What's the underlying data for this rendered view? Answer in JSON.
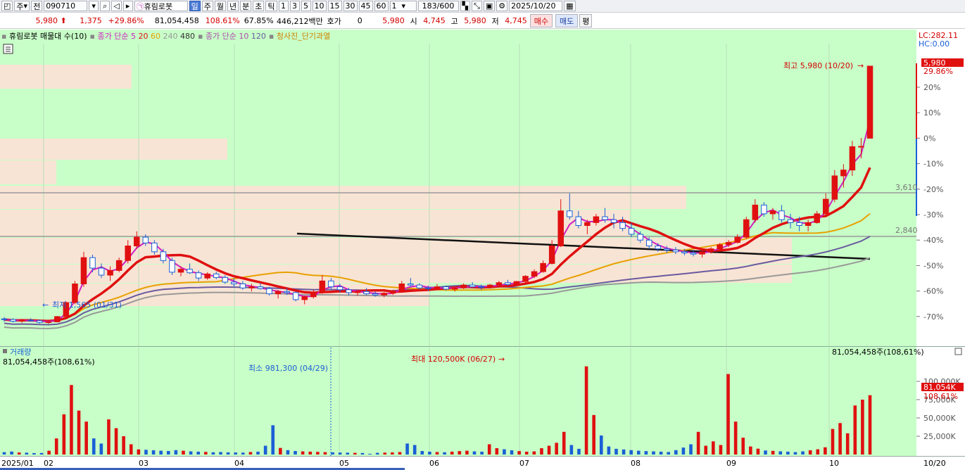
{
  "toolbar": {
    "market": "주",
    "market2": "전",
    "code": "090710",
    "stock_name": "휴림로봇",
    "periods": [
      "일",
      "주",
      "월",
      "년",
      "분",
      "초",
      "틱"
    ],
    "minutes": [
      "1",
      "3",
      "5",
      "10",
      "15",
      "30",
      "45",
      "60"
    ],
    "unit": "1",
    "count": "183/600",
    "date": "2025/10/20"
  },
  "quote": {
    "price": "5,980",
    "change": "1,375",
    "change_pct": "+29.86%",
    "volume": "81,054,458",
    "volume_ratio": "108.61%",
    "turnover": "67.85%",
    "amount": "446,212백만",
    "hoga_label": "호가",
    "hoga_value": "0",
    "hoga_price": "5,980",
    "open_label": "시",
    "open": "4,745",
    "high_label": "고",
    "high": "5,980",
    "low_label": "저",
    "low": "4,745",
    "buy": "매수",
    "sell": "매도",
    "avg": "평"
  },
  "legend": {
    "item1": "휴림로봇 매물대 수(10)",
    "item2": "종가 단순 5",
    "item2_20": "20",
    "item2_60": "60",
    "item2_240": "240",
    "item2_480": "480",
    "item3": "종가 단순 10",
    "item3_120": "120",
    "item4": "청사진_단기과열"
  },
  "price_panel": {
    "lc": "LC:282.11",
    "hc": "HC:0.00",
    "max_label": "최고 5,980 (10/20)",
    "min_label": "최저 1,565 (01/31)",
    "current_tag": "5,980",
    "current_pct": "29.86%",
    "line1_label": "3,610",
    "line2_label": "2,840",
    "y_ticks": [
      "20%",
      "10%",
      "0%",
      "-10%",
      "-20%",
      "-30%",
      "-40%",
      "-50%",
      "-60%",
      "-70%"
    ]
  },
  "volume_panel": {
    "title": "거래량",
    "left_value": "81,054,458주(108,61%)",
    "right_value": "81,054,458주(108,61%)",
    "max_label": "최대 120,500K (06/27)",
    "min_label": "최소 981,300 (04/29)",
    "current_tag": "81,054K",
    "current_pct": "108.61%",
    "y_ticks": [
      "100,000K",
      "75,000K",
      "50,000K",
      "25,000K"
    ]
  },
  "x_axis": [
    "2025/01",
    "02",
    "03",
    "04",
    "05",
    "06",
    "07",
    "08",
    "09",
    "10",
    "10/20"
  ],
  "colors": {
    "up": "#e01010",
    "down": "#1b5fd6",
    "ma5": "#d020c0",
    "ma20": "#e01010",
    "ma60": "#e8a000",
    "ma120": "#6a5aa0",
    "ma240": "#999999",
    "panel_bg": "#c8ffc8",
    "volume_profile": "#f8e4d4"
  },
  "chart_data": {
    "type": "candlestick",
    "ylim": [
      1400,
      6100
    ],
    "candles": [
      [
        1650,
        1680,
        1600,
        1640
      ],
      [
        1640,
        1660,
        1590,
        1610
      ],
      [
        1610,
        1650,
        1580,
        1630
      ],
      [
        1630,
        1660,
        1600,
        1620
      ],
      [
        1620,
        1640,
        1570,
        1590
      ],
      [
        1590,
        1620,
        1565,
        1600
      ],
      [
        1600,
        1700,
        1590,
        1690
      ],
      [
        1690,
        1950,
        1680,
        1930
      ],
      [
        1930,
        2300,
        1900,
        2250
      ],
      [
        2250,
        2800,
        2200,
        2700
      ],
      [
        2700,
        2750,
        2450,
        2520
      ],
      [
        2520,
        2600,
        2350,
        2400
      ],
      [
        2400,
        2550,
        2300,
        2480
      ],
      [
        2480,
        2700,
        2450,
        2650
      ],
      [
        2650,
        3000,
        2600,
        2900
      ],
      [
        2900,
        3150,
        2850,
        3050
      ],
      [
        3050,
        3100,
        2900,
        2950
      ],
      [
        2950,
        3000,
        2750,
        2800
      ],
      [
        2800,
        2850,
        2600,
        2650
      ],
      [
        2650,
        2700,
        2400,
        2450
      ],
      [
        2450,
        2550,
        2380,
        2500
      ],
      [
        2500,
        2600,
        2420,
        2440
      ],
      [
        2440,
        2480,
        2300,
        2350
      ],
      [
        2350,
        2450,
        2320,
        2420
      ],
      [
        2420,
        2460,
        2330,
        2360
      ],
      [
        2360,
        2400,
        2250,
        2280
      ],
      [
        2280,
        2350,
        2200,
        2250
      ],
      [
        2250,
        2300,
        2150,
        2180
      ],
      [
        2180,
        2250,
        2120,
        2200
      ],
      [
        2200,
        2260,
        2150,
        2170
      ],
      [
        2170,
        2200,
        2050,
        2080
      ],
      [
        2080,
        2150,
        2000,
        2120
      ],
      [
        2120,
        2180,
        2060,
        2100
      ],
      [
        2100,
        2120,
        1950,
        1980
      ],
      [
        1980,
        2050,
        1900,
        2030
      ],
      [
        2030,
        2150,
        2000,
        2100
      ],
      [
        2100,
        2400,
        2080,
        2300
      ],
      [
        2300,
        2350,
        2150,
        2200
      ],
      [
        2200,
        2250,
        2100,
        2150
      ],
      [
        2150,
        2180,
        2050,
        2100
      ],
      [
        2100,
        2150,
        2050,
        2120
      ],
      [
        2120,
        2180,
        2060,
        2080
      ],
      [
        2080,
        2120,
        2030,
        2060
      ],
      [
        2060,
        2110,
        2020,
        2090
      ],
      [
        2090,
        2150,
        2060,
        2120
      ],
      [
        2120,
        2300,
        2100,
        2250
      ],
      [
        2250,
        2350,
        2200,
        2230
      ],
      [
        2230,
        2260,
        2150,
        2180
      ],
      [
        2180,
        2220,
        2130,
        2170
      ],
      [
        2170,
        2250,
        2150,
        2200
      ],
      [
        2200,
        2220,
        2140,
        2160
      ],
      [
        2160,
        2200,
        2120,
        2180
      ],
      [
        2180,
        2260,
        2160,
        2230
      ],
      [
        2230,
        2280,
        2180,
        2200
      ],
      [
        2200,
        2240,
        2150,
        2190
      ],
      [
        2190,
        2250,
        2170,
        2230
      ],
      [
        2230,
        2300,
        2200,
        2270
      ],
      [
        2270,
        2320,
        2220,
        2240
      ],
      [
        2240,
        2300,
        2220,
        2290
      ],
      [
        2290,
        2400,
        2270,
        2380
      ],
      [
        2380,
        2500,
        2350,
        2460
      ],
      [
        2460,
        2650,
        2440,
        2600
      ],
      [
        2600,
        3000,
        2580,
        2900
      ],
      [
        2900,
        3700,
        2880,
        3500
      ],
      [
        3500,
        3800,
        3350,
        3400
      ],
      [
        3400,
        3500,
        3200,
        3250
      ],
      [
        3250,
        3350,
        3100,
        3300
      ],
      [
        3300,
        3450,
        3250,
        3400
      ],
      [
        3400,
        3550,
        3300,
        3350
      ],
      [
        3350,
        3450,
        3200,
        3300
      ],
      [
        3300,
        3400,
        3150,
        3200
      ],
      [
        3200,
        3300,
        3050,
        3100
      ],
      [
        3100,
        3150,
        2950,
        3000
      ],
      [
        3000,
        3050,
        2850,
        2900
      ],
      [
        2900,
        2950,
        2800,
        2850
      ],
      [
        2850,
        2900,
        2780,
        2830
      ],
      [
        2830,
        2880,
        2760,
        2800
      ],
      [
        2800,
        2850,
        2740,
        2780
      ],
      [
        2780,
        2830,
        2720,
        2760
      ],
      [
        2760,
        2820,
        2700,
        2800
      ],
      [
        2800,
        2880,
        2770,
        2850
      ],
      [
        2850,
        2950,
        2820,
        2920
      ],
      [
        2920,
        3000,
        2880,
        2960
      ],
      [
        2960,
        3100,
        2940,
        3050
      ],
      [
        3050,
        3400,
        3020,
        3350
      ],
      [
        3350,
        3700,
        3300,
        3600
      ],
      [
        3600,
        3650,
        3400,
        3450
      ],
      [
        3450,
        3550,
        3350,
        3500
      ],
      [
        3500,
        3600,
        3300,
        3350
      ],
      [
        3350,
        3450,
        3200,
        3300
      ],
      [
        3300,
        3400,
        3150,
        3250
      ],
      [
        3250,
        3350,
        3150,
        3300
      ],
      [
        3300,
        3500,
        3280,
        3450
      ],
      [
        3450,
        3800,
        3400,
        3700
      ],
      [
        3700,
        4200,
        3650,
        4100
      ],
      [
        4100,
        4300,
        3900,
        4200
      ],
      [
        4200,
        4700,
        4100,
        4600
      ],
      [
        4600,
        4750,
        4400,
        4605
      ],
      [
        4745,
        5980,
        4745,
        5980
      ]
    ],
    "volume_k": [
      3200,
      4100,
      2800,
      2500,
      1900,
      2100,
      5200,
      22000,
      55000,
      95000,
      60000,
      45000,
      22000,
      15000,
      48000,
      36000,
      25000,
      14000,
      7000,
      6500,
      5800,
      5200,
      4800,
      6000,
      5200,
      4300,
      3900,
      3600,
      3100,
      3400,
      3000,
      2800,
      2600,
      3400,
      3900,
      12000,
      40000,
      9000,
      6000,
      4800,
      4300,
      3900,
      3600,
      3300,
      3000,
      2700,
      2500,
      2300,
      2100,
      981,
      2300,
      2600,
      2900,
      3400,
      15000,
      13000,
      4800,
      3900,
      3400,
      3100,
      3900,
      4700,
      5200,
      4300,
      3900,
      14000,
      8700,
      7200,
      5800,
      4700,
      3900,
      4300,
      8600,
      12000,
      16000,
      31000,
      13000,
      7800,
      120500,
      54000,
      26000,
      11000,
      7800,
      6900,
      6000,
      5200,
      4700,
      4300,
      3900,
      3400,
      6000,
      9500,
      14000,
      31000,
      12000,
      18000,
      13000,
      110000,
      45000,
      23000,
      11000,
      8000,
      5500,
      5000,
      4400,
      3900,
      3300,
      4300,
      5800,
      7200,
      9900,
      35000,
      43000,
      29000,
      67000,
      75000,
      81054
    ],
    "max_price": 5980,
    "min_price": 1565
  }
}
